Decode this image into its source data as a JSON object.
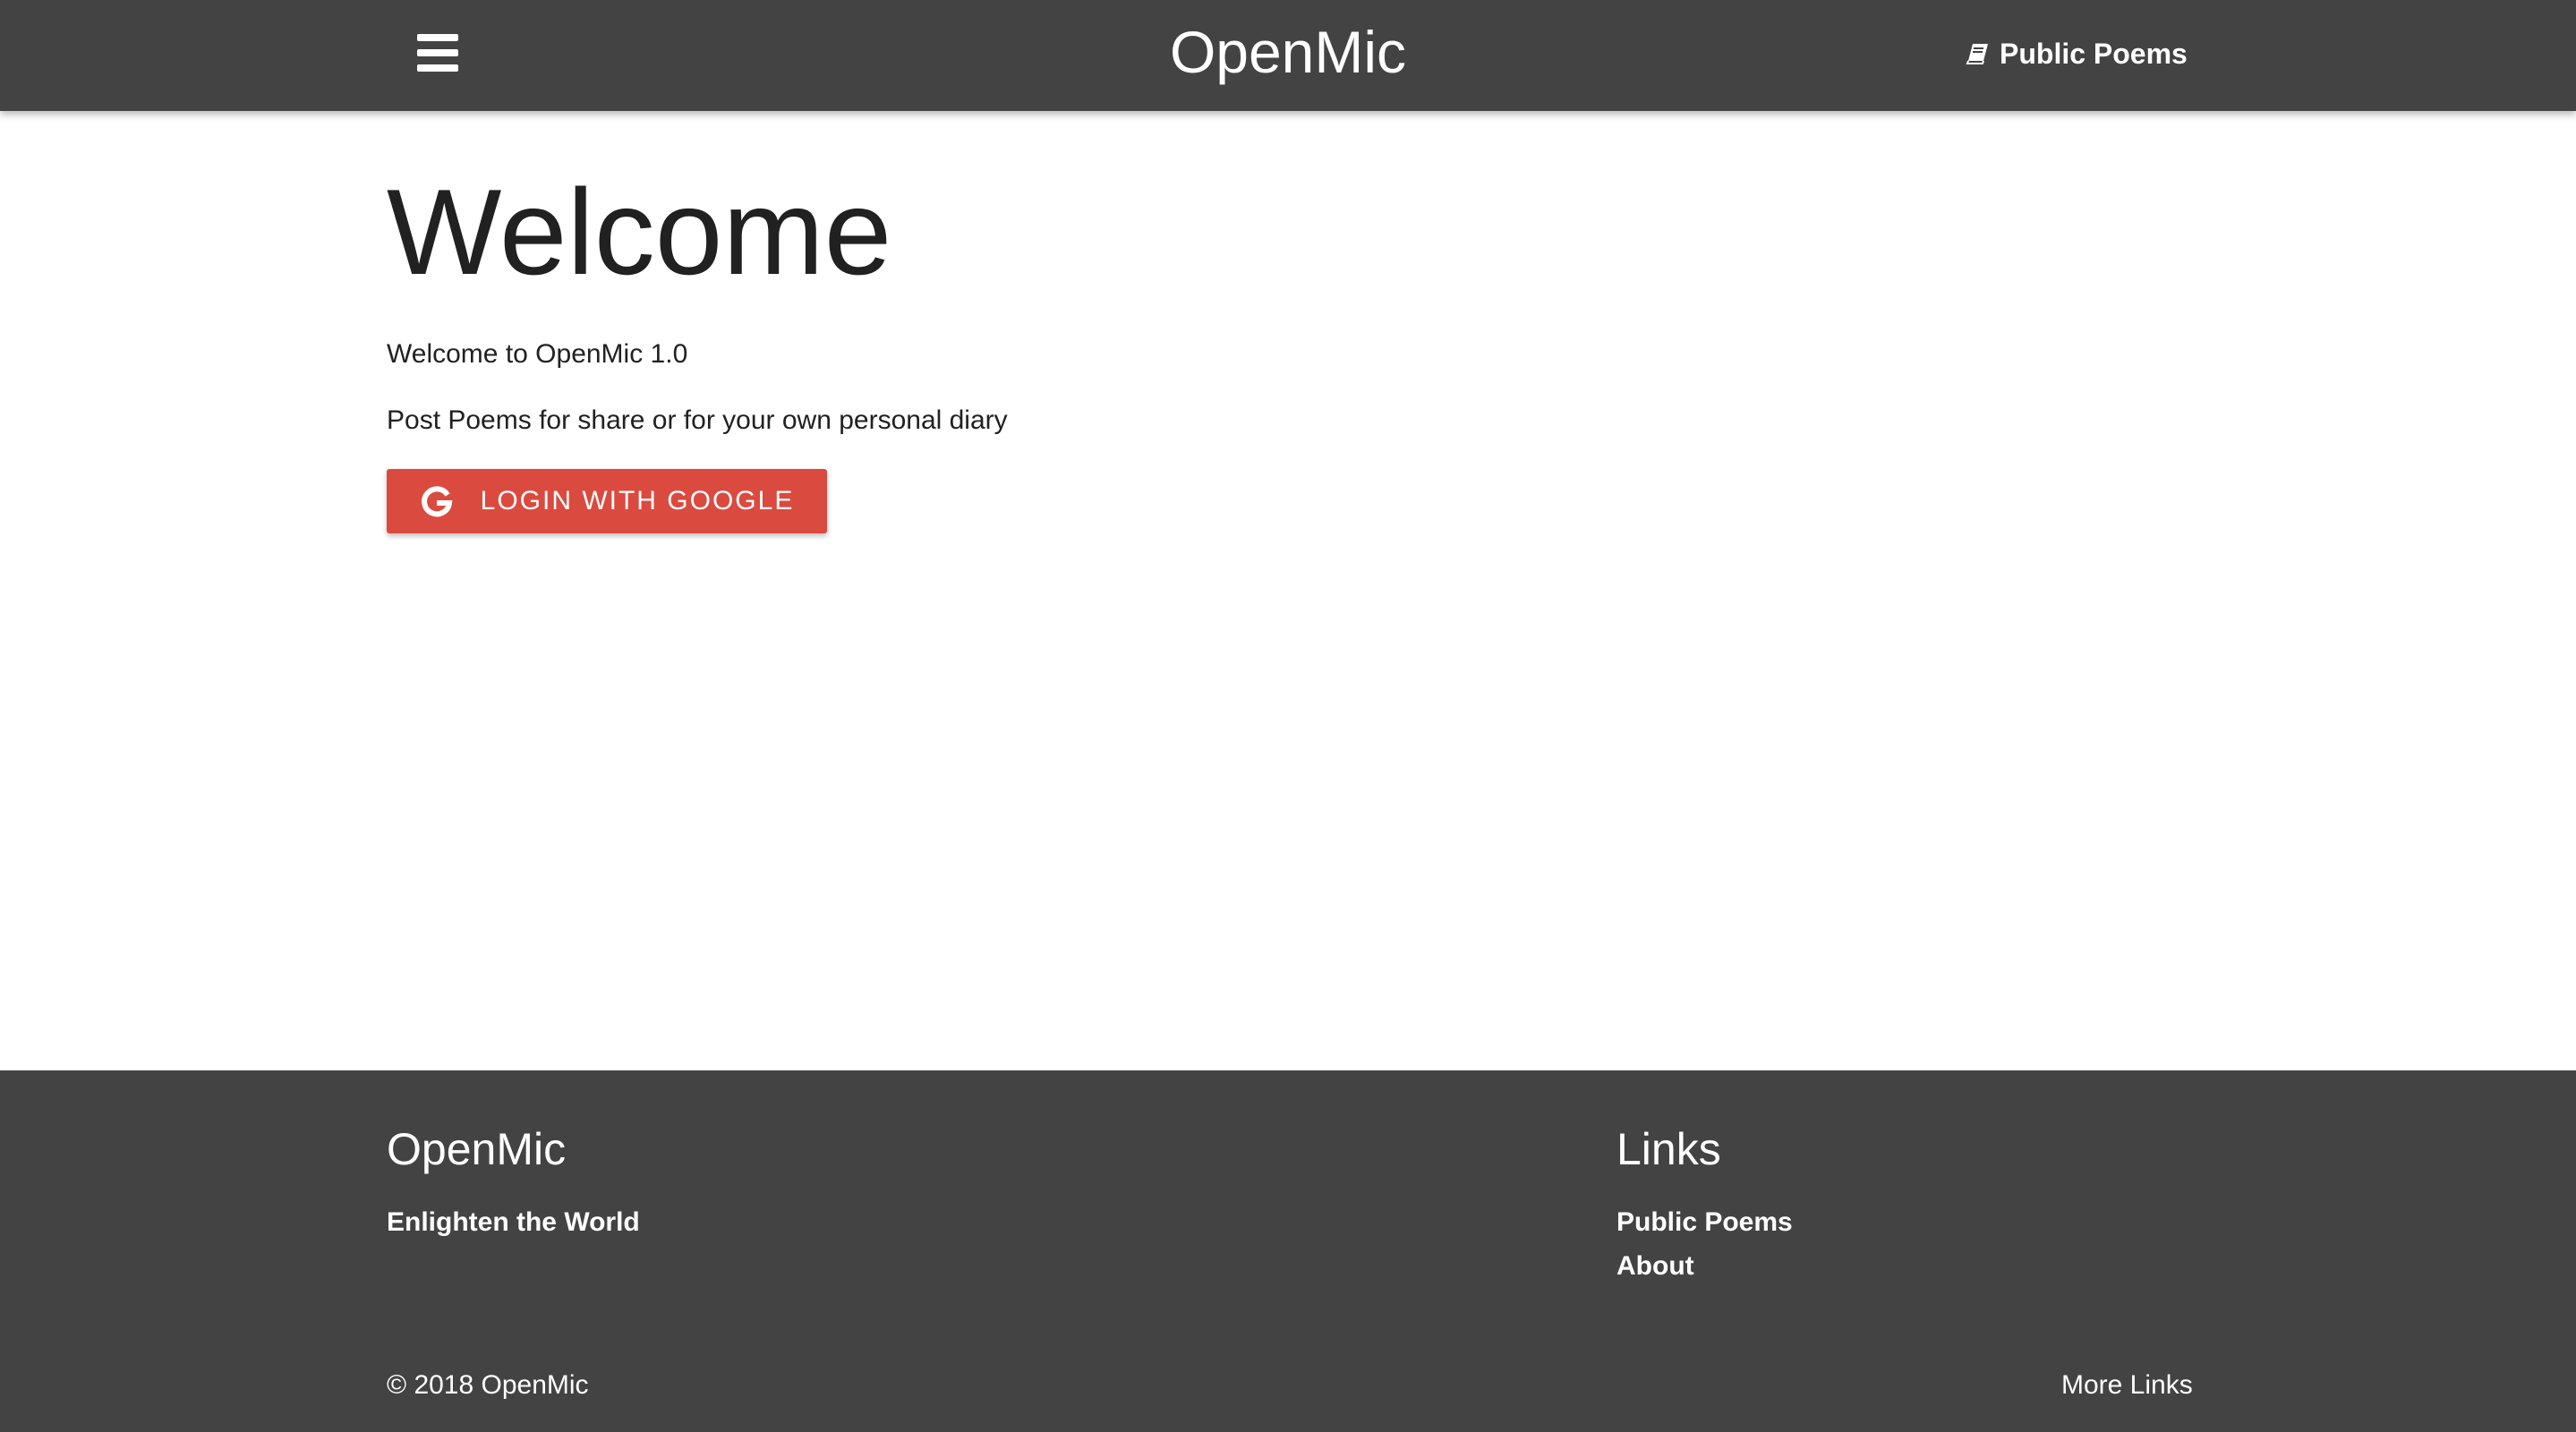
{
  "navbar": {
    "menu_icon": "hamburger-menu-icon",
    "title": "OpenMic",
    "link_icon": "book-icon",
    "link_label": "Public Poems"
  },
  "main": {
    "heading": "Welcome",
    "intro": "Welcome to OpenMic 1.0",
    "tagline": "Post Poems for share or for your own personal diary",
    "login_button": {
      "icon": "google-g-icon",
      "label": "LOGIN WITH GOOGLE"
    }
  },
  "footer": {
    "title": "OpenMic",
    "tagline": "Enlighten the World",
    "links_title": "Links",
    "links": [
      "Public Poems",
      "About"
    ],
    "copyright": "© 2018 OpenMic",
    "more_links": "More Links"
  },
  "colors": {
    "navbar_bg": "#434343",
    "footer_bg": "#434343",
    "google_button": "#db4a3f",
    "text_primary": "#212121"
  }
}
